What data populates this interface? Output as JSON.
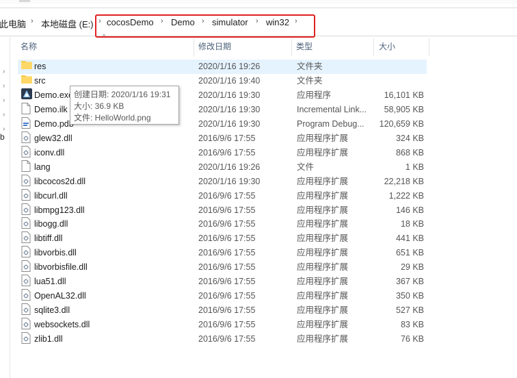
{
  "breadcrumb": {
    "items": [
      "此电脑",
      "本地磁盘 (E:)",
      "cocosDemo",
      "Demo",
      "simulator",
      "win32"
    ],
    "separator": "›"
  },
  "columns": {
    "name": "名称",
    "date": "修改日期",
    "type": "类型",
    "size": "大小"
  },
  "files": [
    {
      "name": "res",
      "date": "2020/1/16 19:26",
      "type": "文件夹",
      "size": "",
      "icon": "folder-icon"
    },
    {
      "name": "src",
      "date": "2020/1/16 19:40",
      "type": "文件夹",
      "size": "",
      "icon": "folder-icon"
    },
    {
      "name": "Demo.exe",
      "date": "2020/1/16 19:30",
      "type": "应用程序",
      "size": "16,101 KB",
      "icon": "exe-icon"
    },
    {
      "name": "Demo.ilk",
      "date": "2020/1/16 19:30",
      "type": "Incremental Link...",
      "size": "58,905 KB",
      "icon": "file-icon"
    },
    {
      "name": "Demo.pdb",
      "date": "2020/1/16 19:30",
      "type": "Program Debug...",
      "size": "120,659 KB",
      "icon": "pdb-icon"
    },
    {
      "name": "glew32.dll",
      "date": "2016/9/6 17:55",
      "type": "应用程序扩展",
      "size": "324 KB",
      "icon": "dll-icon"
    },
    {
      "name": "iconv.dll",
      "date": "2016/9/6 17:55",
      "type": "应用程序扩展",
      "size": "868 KB",
      "icon": "dll-icon"
    },
    {
      "name": "lang",
      "date": "2020/1/16 19:26",
      "type": "文件",
      "size": "1 KB",
      "icon": "file-icon"
    },
    {
      "name": "libcocos2d.dll",
      "date": "2020/1/16 19:30",
      "type": "应用程序扩展",
      "size": "22,218 KB",
      "icon": "dll-icon"
    },
    {
      "name": "libcurl.dll",
      "date": "2016/9/6 17:55",
      "type": "应用程序扩展",
      "size": "1,222 KB",
      "icon": "dll-icon"
    },
    {
      "name": "libmpg123.dll",
      "date": "2016/9/6 17:55",
      "type": "应用程序扩展",
      "size": "146 KB",
      "icon": "dll-icon"
    },
    {
      "name": "libogg.dll",
      "date": "2016/9/6 17:55",
      "type": "应用程序扩展",
      "size": "18 KB",
      "icon": "dll-icon"
    },
    {
      "name": "libtiff.dll",
      "date": "2016/9/6 17:55",
      "type": "应用程序扩展",
      "size": "441 KB",
      "icon": "dll-icon"
    },
    {
      "name": "libvorbis.dll",
      "date": "2016/9/6 17:55",
      "type": "应用程序扩展",
      "size": "651 KB",
      "icon": "dll-icon"
    },
    {
      "name": "libvorbisfile.dll",
      "date": "2016/9/6 17:55",
      "type": "应用程序扩展",
      "size": "29 KB",
      "icon": "dll-icon"
    },
    {
      "name": "lua51.dll",
      "date": "2016/9/6 17:55",
      "type": "应用程序扩展",
      "size": "367 KB",
      "icon": "dll-icon"
    },
    {
      "name": "OpenAL32.dll",
      "date": "2016/9/6 17:55",
      "type": "应用程序扩展",
      "size": "350 KB",
      "icon": "dll-icon"
    },
    {
      "name": "sqlite3.dll",
      "date": "2016/9/6 17:55",
      "type": "应用程序扩展",
      "size": "527 KB",
      "icon": "dll-icon"
    },
    {
      "name": "websockets.dll",
      "date": "2016/9/6 17:55",
      "type": "应用程序扩展",
      "size": "83 KB",
      "icon": "dll-icon"
    },
    {
      "name": "zlib1.dll",
      "date": "2016/9/6 17:55",
      "type": "应用程序扩展",
      "size": "76 KB",
      "icon": "dll-icon"
    }
  ],
  "selected_index": 0,
  "tooltip": {
    "created": "创建日期: 2020/1/16 19:31",
    "size": "大小: 36.9 KB",
    "file": "文件: HelloWorld.png"
  },
  "nav_fragment": "b",
  "colors": {
    "selection": "#e5f3ff",
    "highlight_box": "#e02020",
    "folder": "#f6c94e"
  }
}
